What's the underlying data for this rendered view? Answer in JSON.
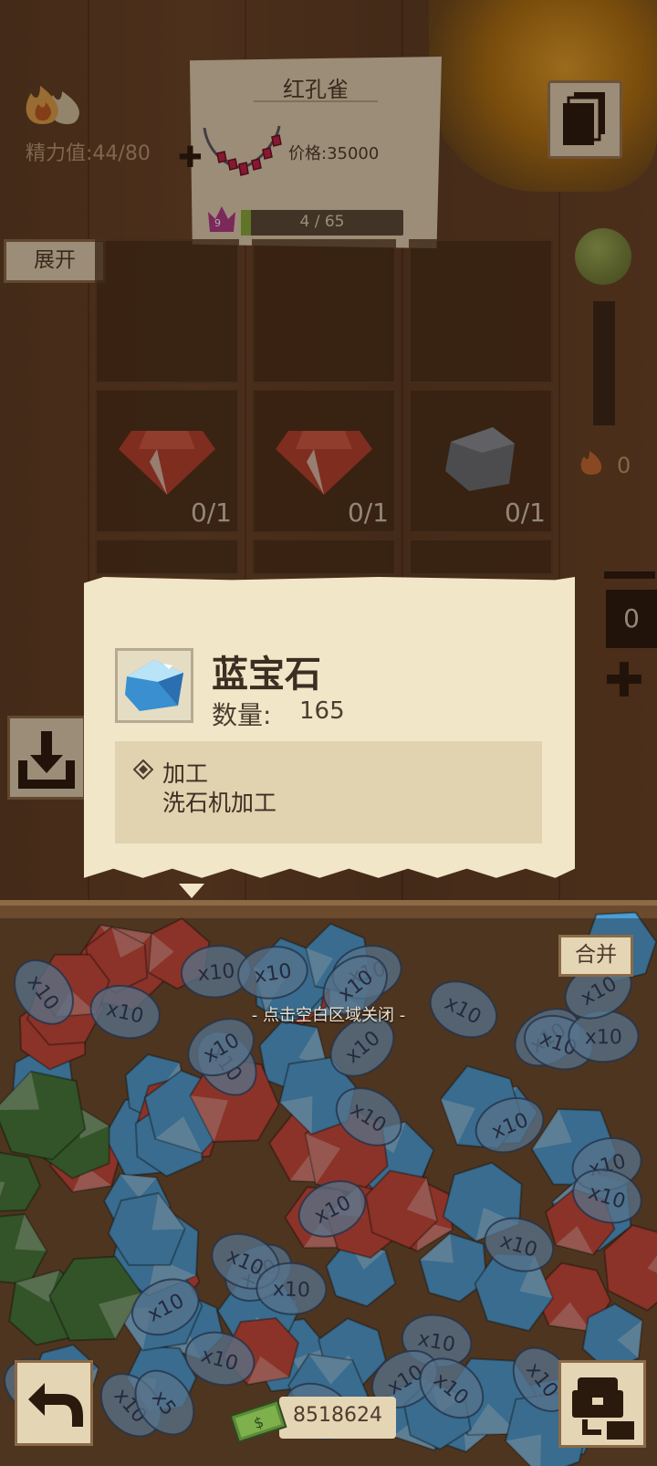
{
  "header": {
    "energy_label": "精力值:",
    "energy_current": "44",
    "energy_max": "80"
  },
  "order": {
    "title": "红孔雀",
    "price_label": "价格:",
    "price_value": "35000",
    "level": "9",
    "progress_current": 4,
    "progress_total": 65,
    "progress_text": "4 / 65"
  },
  "buttons": {
    "expand": "展开",
    "merge": "合并"
  },
  "slots": [
    {
      "gem": "ruby",
      "count": "0/1"
    },
    {
      "gem": "ruby",
      "count": "0/1"
    },
    {
      "gem": "stone",
      "count": "0/1"
    }
  ],
  "side_panel": {
    "fire_count": "0",
    "quantity": "0"
  },
  "popup": {
    "item_name": "蓝宝石",
    "quantity_label": "数量:",
    "quantity_value": "165",
    "process_title": "加工",
    "process_desc": "洗石机加工"
  },
  "bin": {
    "close_hint": "- 点击空白区域关闭 -",
    "stack_labels": [
      "x10",
      "x5"
    ]
  },
  "footer": {
    "money": "8518624"
  },
  "colors": {
    "paper": "#f1e6c8",
    "ruby": "#c8473a",
    "sapphire": "#4a9fd6",
    "emerald": "#3f7a3a",
    "progress": "#8ab03c"
  }
}
